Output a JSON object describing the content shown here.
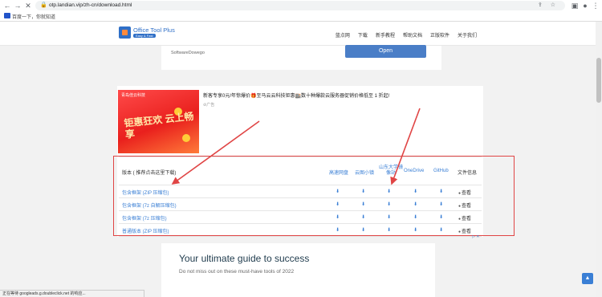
{
  "browser": {
    "url": "otp.landian.vip/zh-cn/download.html",
    "bookmark_label": "百度一下，你就知道"
  },
  "site": {
    "logo_title": "Office Tool Plus",
    "logo_badge": "Easy & Fast",
    "nav": [
      "蓝点网",
      "下载",
      "新手教程",
      "帮助文档",
      "正版软件",
      "关于我们"
    ]
  },
  "top_card": {
    "label": "SoftwareDowego",
    "button": "Open"
  },
  "ad": {
    "image_top_text": "青岛佳云科技",
    "image_main_text": "钜惠狂欢 云上畅享",
    "headline": "新客专享0元/年惊爆价🎁至马云云科技钜惠🏬数十种爆款云服务器促销价格低至 1 折起!",
    "tag": "⊘广告"
  },
  "table": {
    "header_label": "版本 ( 推荐点击这里下载)",
    "columns": [
      "高速网盘",
      "云图小镇",
      "山东大学镜像站",
      "OneDrive",
      "GitHub",
      "文件信息"
    ],
    "rows": [
      {
        "label": "包含框架 (ZIP 压缩包)",
        "view": "查看"
      },
      {
        "label": "包含框架 (7z 自解压缩包)",
        "view": "查看"
      },
      {
        "label": "包含框架 (7z 压缩包)",
        "view": "查看"
      },
      {
        "label": "普通版本 (ZIP 压缩包)",
        "view": "查看"
      }
    ],
    "download_icon": "download-icon"
  },
  "bottom_ad": {
    "title": "Your ultimate guide to success",
    "subtitle": "Do not miss out on these must-have tools of 2022"
  },
  "status_text": "正在等待 googleads.g.doubleclick.net 的响应...",
  "colors": {
    "accent": "#3a7fd5",
    "annotation": "#e04545",
    "button": "#4a7ec7"
  }
}
